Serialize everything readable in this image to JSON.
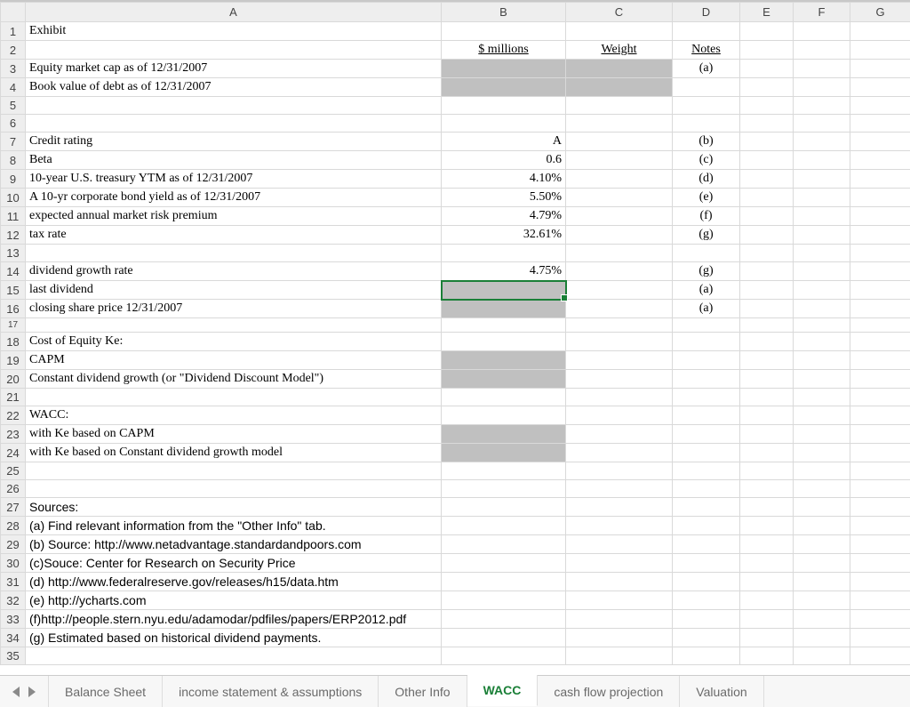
{
  "columns": [
    "A",
    "B",
    "C",
    "D",
    "E",
    "F",
    "G"
  ],
  "rows": {
    "1": {
      "A": "Exhibit"
    },
    "2": {
      "B": "$ millions",
      "C": "Weight",
      "D": "Notes"
    },
    "3": {
      "A": "Equity market cap as of 12/31/2007",
      "D": "(a)"
    },
    "4": {
      "A": "Book value of debt  as of 12/31/2007"
    },
    "7": {
      "A": "Credit rating",
      "B": "A",
      "D": "(b)"
    },
    "8": {
      "A": "Beta",
      "B": "0.6",
      "D": "(c)"
    },
    "9": {
      "A": "10-year U.S. treasury YTM as of 12/31/2007",
      "B": "4.10%",
      "D": "(d)"
    },
    "10": {
      "A": "A 10-yr corporate bond yield as of 12/31/2007",
      "B": "5.50%",
      "D": "(e)"
    },
    "11": {
      "A": "expected annual market risk premium",
      "B": "4.79%",
      "D": "(f)"
    },
    "12": {
      "A": "tax rate",
      "B": "32.61%",
      "D": "(g)"
    },
    "14": {
      "A": "dividend growth rate",
      "B": "4.75%",
      "D": "(g)"
    },
    "15": {
      "A": "last dividend",
      "D": "(a)"
    },
    "16": {
      "A": "closing share price 12/31/2007",
      "D": "(a)"
    },
    "18": {
      "A": "Cost of Equity Ke:"
    },
    "19": {
      "A": " CAPM"
    },
    "20": {
      "A": " Constant dividend growth (or \"Dividend Discount Model\")"
    },
    "22": {
      "A": "WACC:"
    },
    "23": {
      "A": " with Ke based on CAPM"
    },
    "24": {
      "A": " with Ke based on Constant dividend growth model"
    },
    "27": {
      "A": "Sources:"
    },
    "28": {
      "A": "(a) Find relevant information from the \"Other Info\" tab."
    },
    "29": {
      "A": "(b) Source: http://www.netadvantage.standardandpoors.com"
    },
    "30": {
      "A": "(c)Souce: Center for Research on Security Price"
    },
    "31": {
      "A": "(d) http://www.federalreserve.gov/releases/h15/data.htm"
    },
    "32": {
      "A": "(e) http://ycharts.com"
    },
    "33": {
      "A": "(f)http://people.stern.nyu.edu/adamodar/pdfiles/papers/ERP2012.pdf"
    },
    "34": {
      "A": "(g) Estimated based on historical dividend payments."
    }
  },
  "tabs": {
    "items": [
      "Balance Sheet",
      "income statement & assumptions",
      "Other Info",
      "WACC",
      "cash flow projection",
      "Valuation"
    ],
    "active": "WACC"
  }
}
